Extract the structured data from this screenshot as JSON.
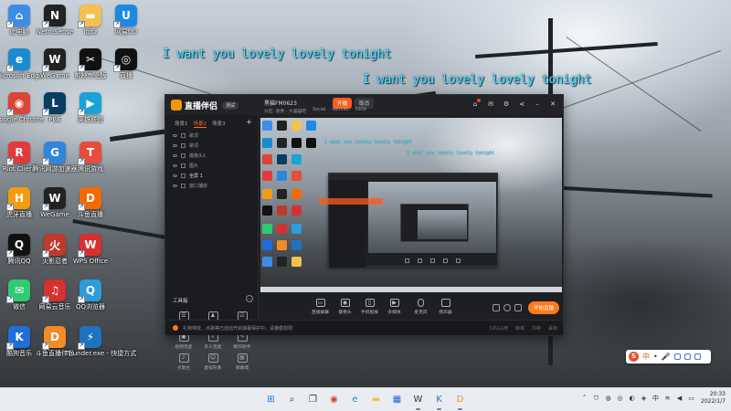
{
  "desktop": {
    "icons": [
      {
        "label": "此电脑",
        "color": "#3a8ee6",
        "glyph": "⌂"
      },
      {
        "label": "NetroSense",
        "color": "#222222",
        "glyph": "N"
      },
      {
        "label": "lqbz",
        "color": "#f2c14e",
        "glyph": "▬"
      },
      {
        "label": "网易UU",
        "color": "#1e88e5",
        "glyph": "U"
      },
      {
        "label": "Microsoft Edge",
        "color": "#1b8bd1",
        "glyph": "e"
      },
      {
        "label": "WeGame",
        "color": "#222222",
        "glyph": "W"
      },
      {
        "label": "剪映专业版",
        "color": "#111111",
        "glyph": "✂"
      },
      {
        "label": "直播",
        "color": "#111111",
        "glyph": "◎"
      },
      {
        "label": "Google Chrome",
        "color": "#db4437",
        "glyph": "◉"
      },
      {
        "label": "PBE",
        "color": "#0a3d62",
        "glyph": "L"
      },
      {
        "label": "英雄联盟",
        "color": "#1aa3d6",
        "glyph": "▶"
      },
      {
        "label": "Riot Client",
        "color": "#e23b3b",
        "glyph": "R"
      },
      {
        "label": "腾讯网游加速器",
        "color": "#2e86de",
        "glyph": "G"
      },
      {
        "label": "腾讯游戏",
        "color": "#e74c3c",
        "glyph": "T"
      },
      {
        "label": "虎牙直播",
        "color": "#f39c12",
        "glyph": "H"
      },
      {
        "label": "WeGame",
        "color": "#222222",
        "glyph": "W"
      },
      {
        "label": "斗鱼直播",
        "color": "#f56a00",
        "glyph": "D"
      },
      {
        "label": "腾讯QQ",
        "color": "#111111",
        "glyph": "Q"
      },
      {
        "label": "火影忍者",
        "color": "#c0392b",
        "glyph": "火"
      },
      {
        "label": "WPS Office",
        "color": "#d63031",
        "glyph": "W"
      },
      {
        "label": "微信",
        "color": "#2ecc71",
        "glyph": "✉"
      },
      {
        "label": "网易云音乐",
        "color": "#d63031",
        "glyph": "♫"
      },
      {
        "label": "QQ浏览器",
        "color": "#2d9cdb",
        "glyph": "Q"
      },
      {
        "label": "酷狗音乐",
        "color": "#1e6fd9",
        "glyph": "K"
      },
      {
        "label": "斗鱼直播伴侣",
        "color": "#f28c28",
        "glyph": "D"
      },
      {
        "label": "Thunder.exe - 快捷方式",
        "color": "#1e73be",
        "glyph": "⚡"
      }
    ]
  },
  "lyrics": {
    "line1": "I want you lovely lovely tonight",
    "line2": "I want you lovely lovely tonight"
  },
  "app": {
    "title": "直播伴侣",
    "version": "测试",
    "room_name": "黑猫FM0623",
    "btn_live": "开播",
    "btn_cancel": "取消",
    "meta": [
      "分区: 星秀 · 大猫猫吧",
      "Social",
      "480142",
      "5939"
    ],
    "scene_tabs": [
      "场景1",
      "场景2",
      "场景3"
    ],
    "sources": [
      "歌词",
      "歌词",
      "摄像头1",
      "图片",
      "全屏 1",
      "窗口捕获"
    ],
    "tools_title": "工具箱",
    "tools": [
      {
        "label": "弹幕助手",
        "glyph": "☰"
      },
      {
        "label": "房管助手",
        "glyph": "♟"
      },
      {
        "label": "主播任务",
        "glyph": "☑"
      },
      {
        "label": "视频连麦",
        "glyph": "▣"
      },
      {
        "label": "多人连麦",
        "glyph": "⇩"
      },
      {
        "label": "精华助手",
        "glyph": "✎"
      },
      {
        "label": "点歌台",
        "glyph": "♪"
      },
      {
        "label": "虚拟形象",
        "glyph": "☺"
      },
      {
        "label": "弹幕墙",
        "glyph": "▤"
      }
    ],
    "preview_lyric_a": "I want you lovely lovely tonight",
    "preview_lyric_b": "I want you lovely lovely tonight",
    "bottom_tools": [
      {
        "label": "直播屏幕",
        "glyph": "▭"
      },
      {
        "label": "摄像头",
        "glyph": "◉"
      },
      {
        "label": "手机投屏",
        "glyph": "▯"
      },
      {
        "label": "多媒体",
        "glyph": "▶"
      }
    ],
    "mic_label": "麦克风",
    "speaker_label": "扬声器",
    "start_button": "开始直播",
    "status_text": "礼物特效、点歌等已自动开启弹幕保护中，请遵循规则",
    "stats": [
      "CPU占用",
      "帧率",
      "内存",
      "丢帧"
    ]
  },
  "ime": {
    "logo": "S",
    "lang": "中"
  },
  "taskbar": {
    "apps": [
      {
        "name": "windows-start",
        "glyph": "⊞",
        "color": "#1a73e8"
      },
      {
        "name": "search",
        "glyph": "⌕",
        "color": "#333333"
      },
      {
        "name": "task-view",
        "glyph": "❐",
        "color": "#333333"
      },
      {
        "name": "chrome",
        "glyph": "◉",
        "color": "#db4437"
      },
      {
        "name": "edge",
        "glyph": "e",
        "color": "#1b8bd1"
      },
      {
        "name": "file-explorer",
        "glyph": "▬",
        "color": "#f2c14e"
      },
      {
        "name": "store",
        "glyph": "▦",
        "color": "#2563eb"
      },
      {
        "name": "wegame",
        "glyph": "W",
        "color": "#333333"
      },
      {
        "name": "kugou",
        "glyph": "K",
        "color": "#1e6fd9"
      },
      {
        "name": "douyu-assistant",
        "glyph": "D",
        "color": "#f28c28"
      }
    ],
    "time": "20:33",
    "date": "2022/1/7"
  }
}
